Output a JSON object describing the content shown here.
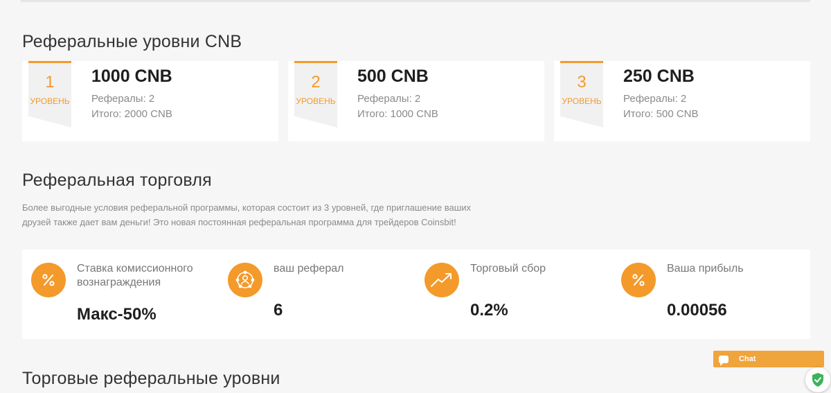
{
  "referral_levels": {
    "title": "Реферальные уровни CNB",
    "level_word": "УРОВЕНЬ",
    "items": [
      {
        "number": "1",
        "amount": "1000 CNB",
        "referrals": "Рефералы: 2",
        "total": "Итого: 2000 CNB"
      },
      {
        "number": "2",
        "amount": "500 CNB",
        "referrals": "Рефералы: 2",
        "total": "Итого: 1000 CNB"
      },
      {
        "number": "3",
        "amount": "250 CNB",
        "referrals": "Рефералы: 2",
        "total": "Итого: 500 CNB"
      }
    ]
  },
  "referral_trading": {
    "title": "Реферальная торговля",
    "description": "Более выгодные условия реферальной программы, которая состоит из 3 уровней, где приглашение ваших друзей также дает вам деньги! Это новая постоянная реферальная программа для трейдеров Coinsbit!",
    "stats": [
      {
        "icon": "percent-icon",
        "label": "Ставка комиссионного вознаграждения",
        "value": "Макс-50%"
      },
      {
        "icon": "referral-network-icon",
        "label": "ваш реферал",
        "value": "6"
      },
      {
        "icon": "trend-up-icon",
        "label": "Торговый сбор",
        "value": "0.2%"
      },
      {
        "icon": "percent-icon",
        "label": "Ваша прибыль",
        "value": "0.00056"
      }
    ]
  },
  "trading_levels": {
    "title": "Торговые реферальные уровни"
  },
  "chat_widget": {
    "label": "Chat"
  },
  "colors": {
    "accent": "#f39a2b",
    "background": "#f6f6f6",
    "card": "#ffffff",
    "muted_text": "#8a8a8a",
    "shield": "#3cb35a"
  }
}
